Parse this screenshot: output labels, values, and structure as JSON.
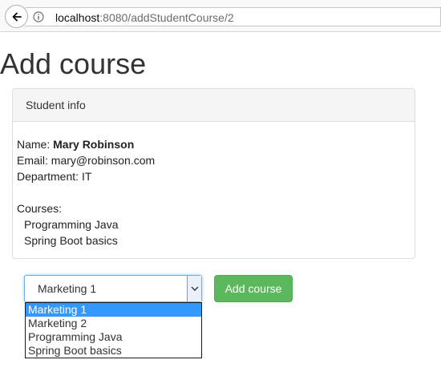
{
  "browser": {
    "url_host": "localhost",
    "url_rest": ":8080/addStudentCourse/2",
    "icons": {
      "back": "back-arrow-icon",
      "info": "info-icon"
    }
  },
  "page": {
    "title": "Add course"
  },
  "panel": {
    "heading": "Student info",
    "name_label": "Name: ",
    "name_value": "Mary Robinson",
    "email_label": "Email: ",
    "email_value": "mary@robinson.com",
    "department_label": "Department: ",
    "department_value": "IT",
    "courses_label": "Courses:",
    "courses": [
      "Programming Java",
      "Spring Boot basics"
    ]
  },
  "form": {
    "selected_course": "Marketing 1",
    "options": [
      "Marketing 1",
      "Marketing 2",
      "Programming Java",
      "Spring Boot basics"
    ],
    "highlighted_option": "Marketing 1",
    "submit_label": "Add course",
    "colors": {
      "button": "#5cb85c",
      "highlight": "#3399ff"
    },
    "icons": {
      "select_arrow": "chevron-down-icon"
    }
  }
}
